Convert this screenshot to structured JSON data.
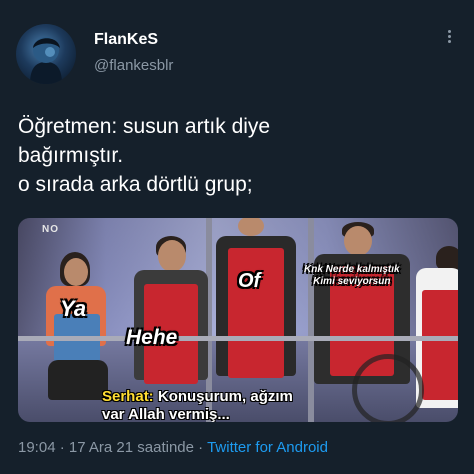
{
  "user": {
    "display_name": "FlanKeS",
    "handle": "@flankesblr"
  },
  "tweet": {
    "lines": [
      "Öğretmen: susun artık diye",
      "bağırmıştır.",
      "o sırada arka dörtlü grup;"
    ]
  },
  "media": {
    "corner_mark": "NO",
    "labels": {
      "ya": "Ya",
      "hehe": "Hehe",
      "of": "Of",
      "knk_line1": "Knk Nerde kalmıştık",
      "knk_line2": "Kimi seviyorsun"
    },
    "subtitle": {
      "speaker": "Serhat:",
      "line1": "Konuşurum, ağzım",
      "line2": "var Allah vermiş..."
    }
  },
  "meta": {
    "time": "19:04",
    "separator1": "·",
    "date": "17 Ara 21 saatinde",
    "separator2": "·",
    "source": "Twitter for Android"
  },
  "icons": {
    "more": "more-options-icon",
    "avatar": "avatar"
  }
}
